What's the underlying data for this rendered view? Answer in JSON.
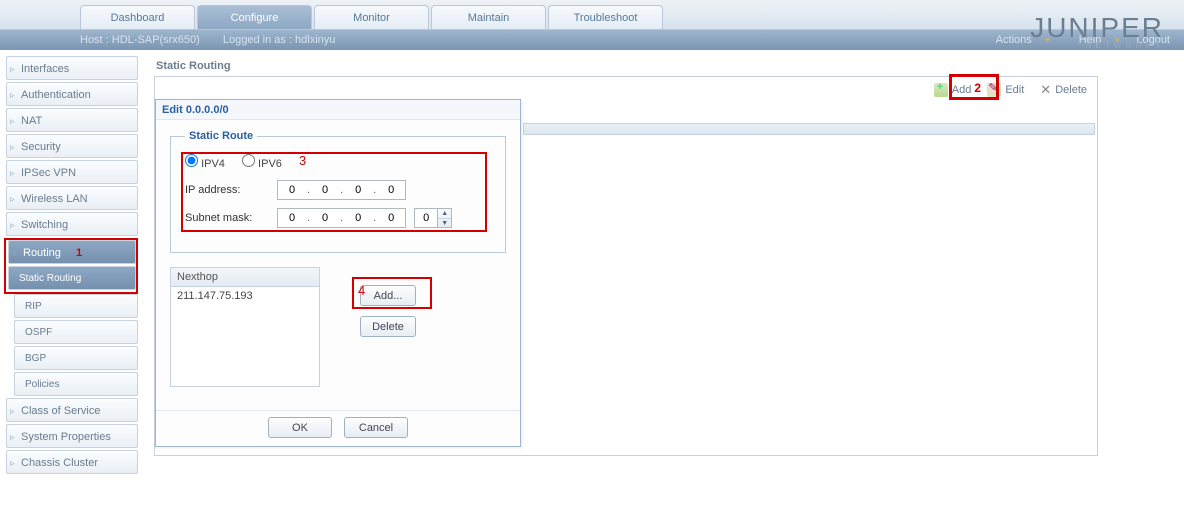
{
  "tabs": {
    "dashboard": "Dashboard",
    "configure": "Configure",
    "monitor": "Monitor",
    "maintain": "Maintain",
    "troubleshoot": "Troubleshoot"
  },
  "logo": {
    "main": "JUNIPER",
    "sub": "NETWORKS"
  },
  "subbar": {
    "host": "Host : HDL-SAP(srx650)",
    "login": "Logged in as : hdlxinyu",
    "actions": "Actions",
    "help": "Help",
    "logout": "Logout"
  },
  "sidebar": {
    "interfaces": "Interfaces",
    "authentication": "Authentication",
    "nat": "NAT",
    "security": "Security",
    "ipsec": "IPSec VPN",
    "wlan": "Wireless LAN",
    "switching": "Switching",
    "routing": "Routing",
    "static_routing": "Static Routing",
    "rip": "RIP",
    "ospf": "OSPF",
    "bgp": "BGP",
    "policies": "Policies",
    "cos": "Class of Service",
    "sysprops": "System Properties",
    "chassis": "Chassis Cluster"
  },
  "page": {
    "title": "Static Routing"
  },
  "toolbar": {
    "add": "Add",
    "edit": "Edit",
    "delete": "Delete"
  },
  "dialog": {
    "title": "Edit 0.0.0.0/0",
    "legend": "Static Route",
    "ipv4": "IPV4",
    "ipv6": "IPV6",
    "ip_label": "IP address:",
    "mask_label": "Subnet mask:",
    "ip": {
      "a": "0",
      "b": "0",
      "c": "0",
      "d": "0"
    },
    "mask": {
      "a": "0",
      "b": "0",
      "c": "0",
      "d": "0",
      "bits": "0"
    },
    "nexthop_header": "Nexthop",
    "nexthop_rows": [
      "211.147.75.193"
    ],
    "add_btn": "Add...",
    "delete_btn": "Delete",
    "ok": "OK",
    "cancel": "Cancel"
  },
  "annotations": {
    "a1": "1",
    "a2": "2",
    "a3": "3",
    "a4": "4"
  }
}
